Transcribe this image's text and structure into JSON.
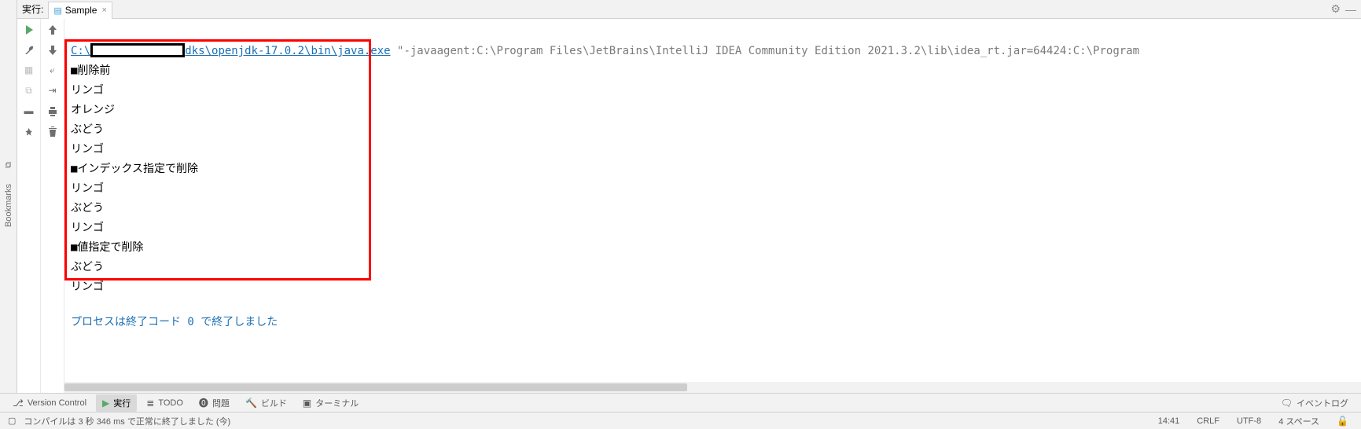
{
  "header": {
    "run_label": "実行:",
    "tab_name": "Sample"
  },
  "left_rail": {
    "item1_icon": "⧉",
    "item2": "Bookmarks"
  },
  "console": {
    "cmd_prefix": "C:\\",
    "cmd_path_tail": "dks\\openjdk-17.0.2\\bin\\java.exe",
    "cmd_args": " \"-javaagent:C:\\Program Files\\JetBrains\\IntelliJ IDEA Community Edition 2021.3.2\\lib\\idea_rt.jar=64424:C:\\Program",
    "lines": [
      "■削除前",
      "リンゴ",
      "オレンジ",
      "ぶどう",
      "リンゴ",
      "■インデックス指定で削除",
      "リンゴ",
      "ぶどう",
      "リンゴ",
      "■値指定で削除",
      "ぶどう",
      "リンゴ"
    ],
    "exit": "プロセスは終了コード 0 で終了しました"
  },
  "bottom_tabs": {
    "vcs": "Version Control",
    "run": "実行",
    "todo": "TODO",
    "problem": "問題",
    "build": "ビルド",
    "terminal": "ターミナル",
    "eventlog": "イベントログ"
  },
  "status": {
    "msg": "コンパイルは 3 秒 346 ms で正常に終了しました (今)",
    "time": "14:41",
    "eol": "CRLF",
    "enc": "UTF-8",
    "indent": "4 スペース"
  }
}
